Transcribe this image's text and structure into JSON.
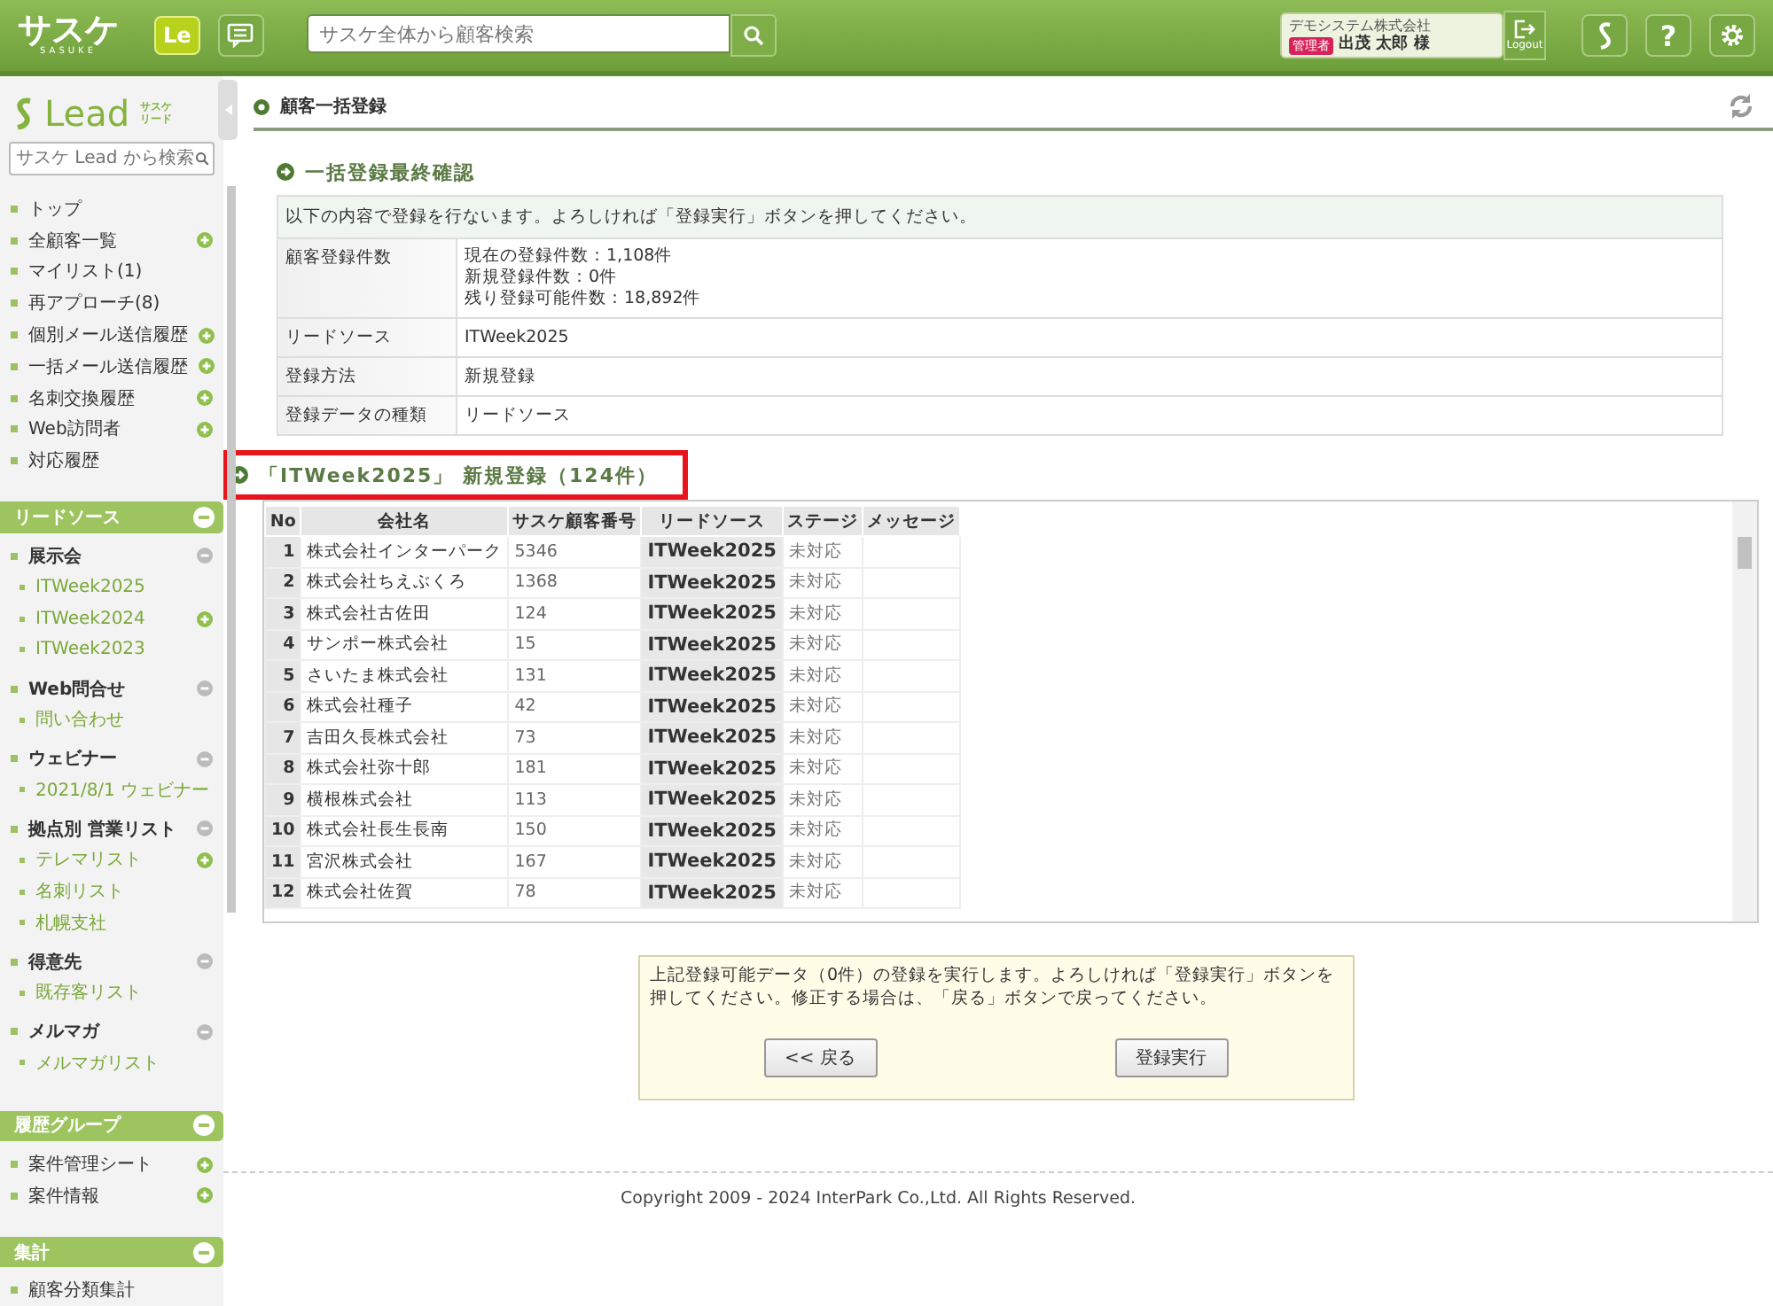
{
  "header": {
    "logo": "サスケ",
    "logo_sub": "SASUKE",
    "app_badge": "Le",
    "search": {
      "placeholder": "サスケ全体から顧客検索"
    },
    "user": {
      "company": "デモシステム株式会社",
      "role": "管理者",
      "name": "出茂 太郎 様"
    },
    "logout": "Logout",
    "help": "?"
  },
  "sidebar": {
    "logo": "Lead",
    "logo_sub": [
      "サスケ",
      "リード"
    ],
    "search": {
      "placeholder": "サスケ Lead から検索"
    },
    "items": [
      {
        "label": "トップ",
        "addable": false
      },
      {
        "label": "全顧客一覧",
        "addable": true
      },
      {
        "label": "マイリスト(1)",
        "addable": false
      },
      {
        "label": "再アプローチ(8)",
        "addable": false
      },
      {
        "label": "個別メール送信履歴",
        "addable": true
      },
      {
        "label": "一括メール送信履歴",
        "addable": true
      },
      {
        "label": "名刺交換履歴",
        "addable": true
      },
      {
        "label": "Web訪問者",
        "addable": true
      },
      {
        "label": "対応履歴",
        "addable": false
      }
    ],
    "sections": [
      {
        "title": "リードソース",
        "expanded": true,
        "entries": [
          {
            "kind": "group",
            "label": "展示会",
            "expanded": true,
            "children": [
              {
                "label": "ITWeek2025",
                "addable": false
              },
              {
                "label": "ITWeek2024",
                "addable": true
              },
              {
                "label": "ITWeek2023",
                "addable": false
              }
            ]
          },
          {
            "kind": "group",
            "label": "Web問合せ",
            "expanded": true,
            "children": [
              {
                "label": "問い合わせ",
                "addable": false
              }
            ]
          },
          {
            "kind": "group",
            "label": "ウェビナー",
            "expanded": true,
            "children": [
              {
                "label": "2021/8/1 ウェビナー",
                "addable": false
              }
            ]
          },
          {
            "kind": "group",
            "label": "拠点別 営業リスト",
            "expanded": true,
            "children": [
              {
                "label": "テレマリスト",
                "addable": true
              },
              {
                "label": "名刺リスト",
                "addable": false
              },
              {
                "label": "札幌支社",
                "addable": false
              }
            ]
          },
          {
            "kind": "group",
            "label": "得意先",
            "expanded": true,
            "children": [
              {
                "label": "既存客リスト",
                "addable": false
              }
            ]
          },
          {
            "kind": "group",
            "label": "メルマガ",
            "expanded": true,
            "children": [
              {
                "label": "メルマガリスト",
                "addable": false
              }
            ]
          }
        ]
      },
      {
        "title": "履歴グループ",
        "expanded": true,
        "entries": [
          {
            "kind": "item",
            "label": "案件管理シート",
            "addable": true
          },
          {
            "kind": "item",
            "label": "案件情報",
            "addable": true
          }
        ]
      },
      {
        "title": "集計",
        "expanded": true,
        "entries": [
          {
            "kind": "item",
            "label": "顧客分類集計",
            "addable": false
          }
        ]
      }
    ]
  },
  "main": {
    "title": "顧客一括登録",
    "confirm": {
      "title": "一括登録最終確認",
      "notice": "以下の内容で登録を行ないます。よろしければ「登録実行」ボタンを押してください。",
      "rows": [
        {
          "label": "顧客登録件数",
          "values": [
            "現在の登録件数：1,108件",
            "新規登録件数：0件",
            "残り登録可能件数：18,892件"
          ]
        },
        {
          "label": "リードソース",
          "values": [
            "ITWeek2025"
          ]
        },
        {
          "label": "登録方法",
          "values": [
            "新規登録"
          ]
        },
        {
          "label": "登録データの種類",
          "values": [
            "リードソース"
          ]
        }
      ]
    },
    "list": {
      "title": "「ITWeek2025」 新規登録（124件）",
      "highlighted": true,
      "columns": [
        "No",
        "会社名",
        "サスケ顧客番号",
        "リードソース",
        "ステージ",
        "メッセージ"
      ],
      "rows": [
        [
          "1",
          "株式会社インターパーク",
          "5346",
          "ITWeek2025",
          "未対応"
        ],
        [
          "2",
          "株式会社ちえぶくろ",
          "1368",
          "ITWeek2025",
          "未対応"
        ],
        [
          "3",
          "株式会社古佐田",
          "124",
          "ITWeek2025",
          "未対応"
        ],
        [
          "4",
          "サンポー株式会社",
          "15",
          "ITWeek2025",
          "未対応"
        ],
        [
          "5",
          "さいたま株式会社",
          "131",
          "ITWeek2025",
          "未対応"
        ],
        [
          "6",
          "株式会社種子",
          "42",
          "ITWeek2025",
          "未対応"
        ],
        [
          "7",
          "吉田久長株式会社",
          "73",
          "ITWeek2025",
          "未対応"
        ],
        [
          "8",
          "株式会社弥十郎",
          "181",
          "ITWeek2025",
          "未対応"
        ],
        [
          "9",
          "横根株式会社",
          "113",
          "ITWeek2025",
          "未対応"
        ],
        [
          "10",
          "株式会社長生長南",
          "150",
          "ITWeek2025",
          "未対応"
        ],
        [
          "11",
          "宮沢株式会社",
          "167",
          "ITWeek2025",
          "未対応"
        ],
        [
          "12",
          "株式会社佐賀",
          "78",
          "ITWeek2025",
          "未対応"
        ]
      ]
    },
    "execute": {
      "message": "上記登録可能データ（0件）の登録を実行します。よろしければ「登録実行」ボタンを押してください。修正する場合は、「戻る」ボタンで戻ってください。",
      "back": "<< 戻る",
      "submit": "登録実行"
    },
    "copyright": "Copyright 2009 - 2024 InterPark Co.,Ltd. All Rights Reserved."
  }
}
